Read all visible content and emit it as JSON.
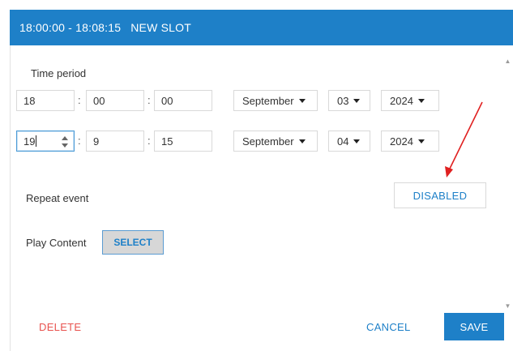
{
  "header": {
    "time_range": "18:00:00 - 18:08:15",
    "title": "NEW SLOT",
    "color": "#1e80c8"
  },
  "form": {
    "time_period_label": "Time period",
    "start": {
      "hour": "18",
      "minute": "00",
      "second": "00",
      "month": "September",
      "day": "03",
      "year": "2024"
    },
    "end": {
      "hour": "19",
      "minute": "9",
      "second": "15",
      "month": "September",
      "day": "04",
      "year": "2024"
    },
    "colon": ":",
    "repeat_label": "Repeat event",
    "repeat_button": "DISABLED",
    "play_content_label": "Play Content",
    "select_button": "SELECT"
  },
  "footer": {
    "delete_label": "DELETE",
    "cancel_label": "CANCEL",
    "save_label": "SAVE"
  },
  "colors": {
    "accent": "#1e80c8",
    "danger": "#e8534f",
    "annotation": "#e02020"
  }
}
